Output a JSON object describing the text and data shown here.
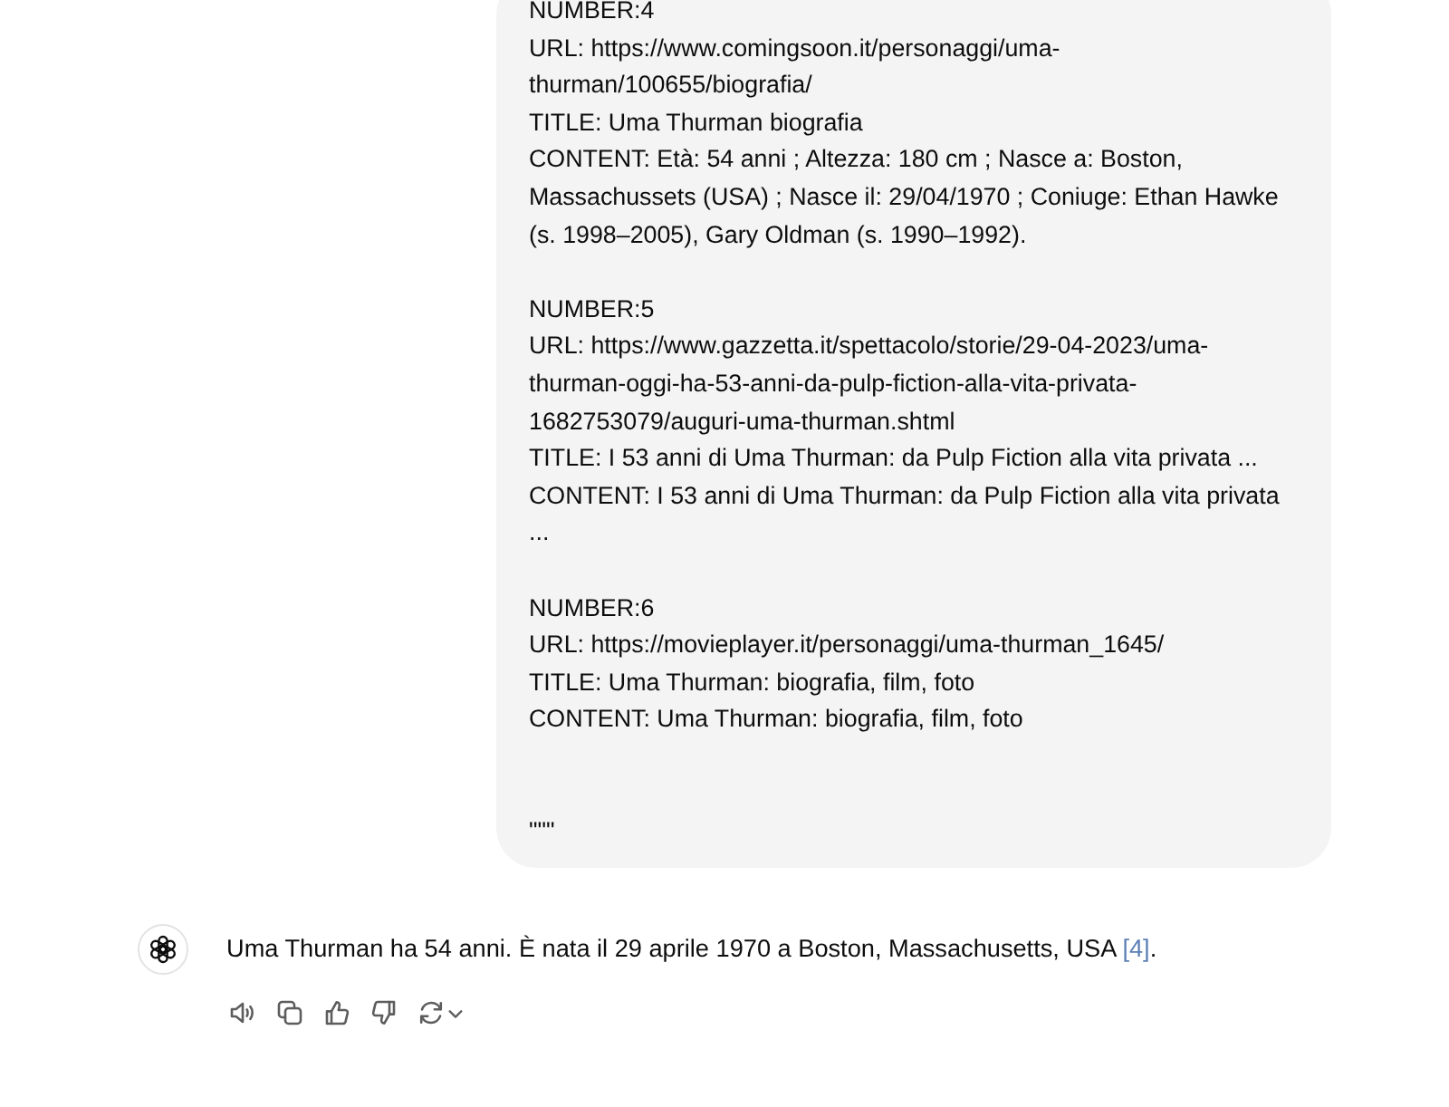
{
  "user_message": {
    "blocks": [
      {
        "lines": [
          "NUMBER:4",
          "URL: https://www.comingsoon.it/personaggi/uma-thurman/100655/biografia/",
          "TITLE: Uma Thurman biografia",
          "CONTENT: Età: 54 anni ; Altezza: 180 cm ; Nasce a: Boston, Massachussets (USA) ; Nasce il: 29/04/1970 ; Coniuge: Ethan Hawke (s. 1998–2005), Gary Oldman (s. 1990–1992)."
        ]
      },
      {
        "lines": [
          "NUMBER:5",
          "URL: https://www.gazzetta.it/spettacolo/storie/29-04-2023/uma-thurman-oggi-ha-53-anni-da-pulp-fiction-alla-vita-privata-1682753079/auguri-uma-thurman.shtml",
          "TITLE: I 53 anni di Uma Thurman: da Pulp Fiction alla vita privata ...",
          "CONTENT: I 53 anni di Uma Thurman: da Pulp Fiction alla vita privata ..."
        ]
      },
      {
        "lines": [
          "NUMBER:6",
          "URL: https://movieplayer.it/personaggi/uma-thurman_1645/",
          "TITLE: Uma Thurman: biografia, film, foto",
          "CONTENT: Uma Thurman: biografia, film, foto"
        ]
      }
    ],
    "closing": "\"\"\""
  },
  "assistant_message": {
    "text": "Uma Thurman ha 54 anni. È nata il 29 aprile 1970 a Boston, Massachusetts, USA ",
    "citation": "[4]",
    "end": "."
  }
}
